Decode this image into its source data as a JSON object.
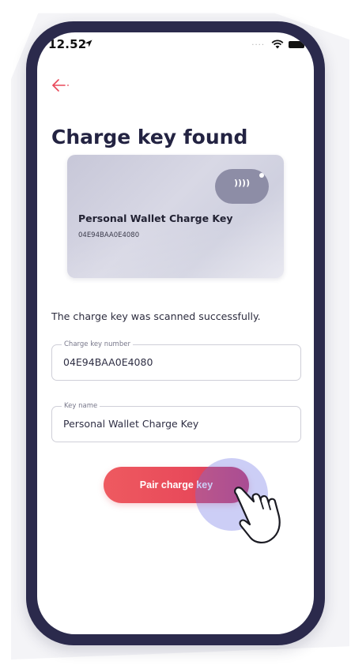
{
  "status_bar": {
    "time": "12.52",
    "signal": "....",
    "location_icon": "location-arrow-icon",
    "wifi_icon": "wifi-icon",
    "battery_icon": "battery-icon"
  },
  "navigation": {
    "back_icon": "arrow-left-icon"
  },
  "page": {
    "title": "Charge key found"
  },
  "card": {
    "name": "Personal Wallet Charge Key",
    "number": "04E94BAA0E4080",
    "nfc_icon": "nfc-waves-icon",
    "nfc_symbol": "))))"
  },
  "message": "The charge key was scanned successfully.",
  "form": {
    "charge_key_number": {
      "label": "Charge key number",
      "value": "04E94BAA0E4080"
    },
    "key_name": {
      "label": "Key name",
      "value": "Personal Wallet Charge Key"
    }
  },
  "actions": {
    "pair_label": "Pair charge key"
  },
  "colors": {
    "accent": "#E8495A",
    "phone_frame": "#2B2A4C",
    "title_text": "#232342",
    "touch_highlight": "#6E73E6"
  }
}
